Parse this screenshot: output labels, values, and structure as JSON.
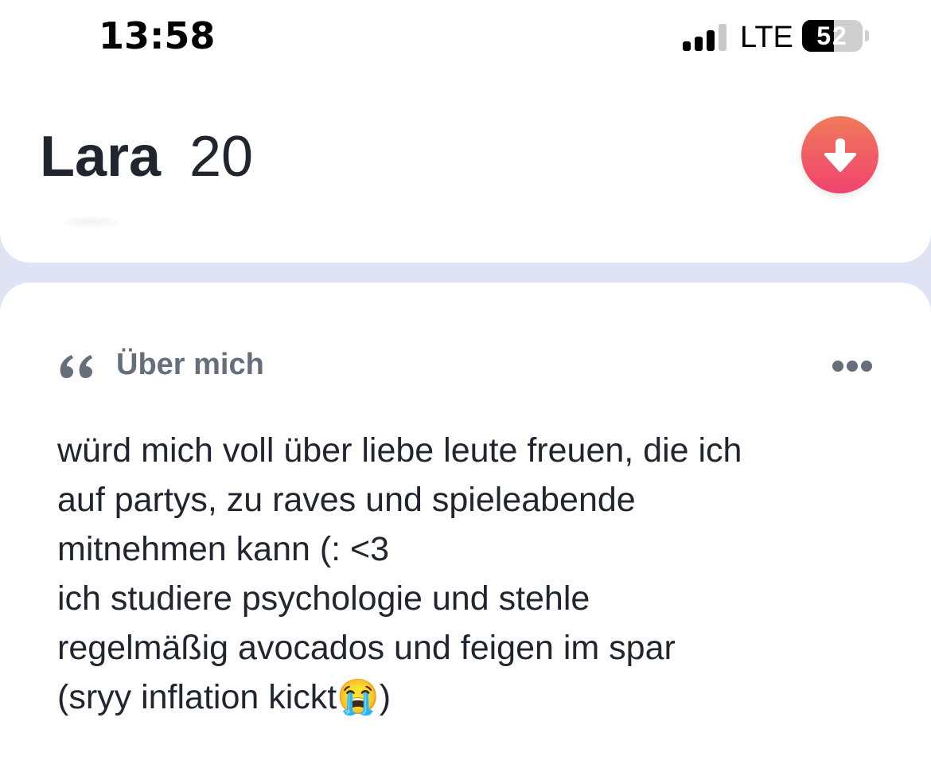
{
  "status_bar": {
    "time": "13:58",
    "network": "LTE",
    "battery_level": "52",
    "battery_fraction": 0.52,
    "signal_bars_active": 3,
    "signal_bars_total": 4
  },
  "profile": {
    "name": "Lara",
    "age": "20",
    "collapse_icon": "arrow-down-icon",
    "accent_gradient": [
      "#f07a5a",
      "#f0436e"
    ]
  },
  "about": {
    "quote_icon": "quote-icon",
    "title": "Über mich",
    "more_icon": "more-dots-icon",
    "bio": "würd mich voll über liebe leute freuen, die ich\nauf partys, zu raves und spieleabende\nmitnehmen kann (: <3\nich studiere psychologie und stehle\nregelmäßig avocados und feigen im spar\n(sryy inflation kickt😭)"
  },
  "colors": {
    "background": "#dfe3f4",
    "card": "#ffffff",
    "text_primary": "#21262e",
    "text_secondary": "#656e7b"
  }
}
